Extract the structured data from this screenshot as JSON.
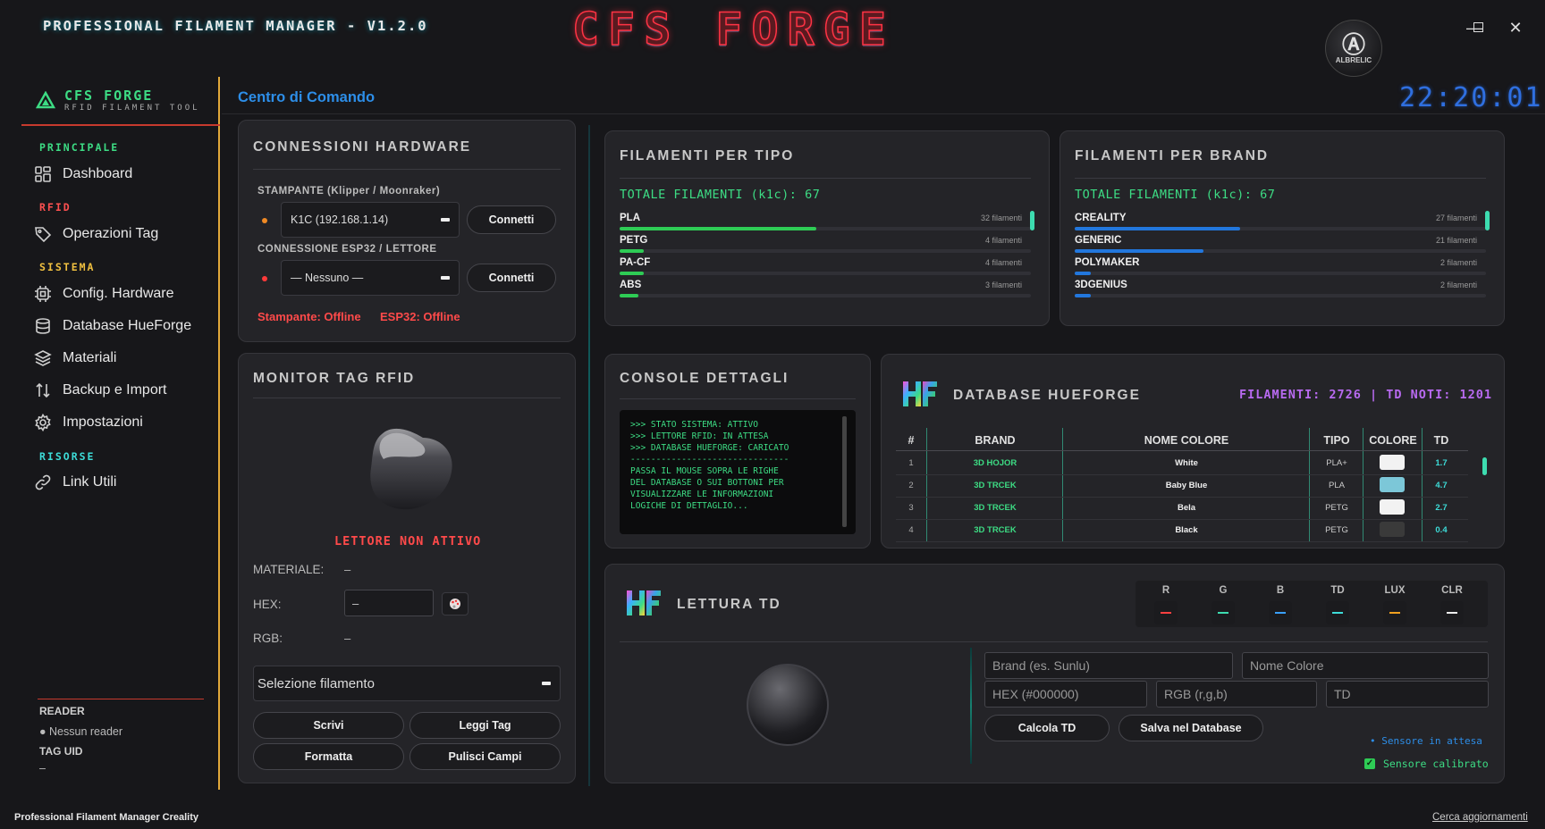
{
  "titlebar": {
    "app_title": "PROFESSIONAL FILAMENT MANAGER - V1.2.0",
    "banner": "CFS FORGE",
    "logo_text": "ALBRELIC",
    "minimize": "—",
    "maximize": "☐",
    "close": "✕"
  },
  "sidebar": {
    "brand_name": "CFS FORGE",
    "brand_sub": "RFID FILAMENT TOOL",
    "sections": {
      "principale": "PRINCIPALE",
      "rfid": "RFID",
      "sistema": "SISTEMA",
      "risorse": "RISORSE"
    },
    "items": [
      {
        "label": "Dashboard",
        "icon": "grid-icon"
      },
      {
        "label": "Operazioni Tag",
        "icon": "tag-icon"
      },
      {
        "label": "Config. Hardware",
        "icon": "chip-icon"
      },
      {
        "label": "Database HueForge",
        "icon": "database-icon"
      },
      {
        "label": "Materiali",
        "icon": "layers-icon"
      },
      {
        "label": "Backup e Import",
        "icon": "arrows-updown-icon"
      },
      {
        "label": "Impostazioni",
        "icon": "gear-icon"
      },
      {
        "label": "Link Utili",
        "icon": "link-icon"
      }
    ],
    "reader_label": "READER",
    "reader_value": "Nessun reader",
    "tag_uid_label": "TAG UID",
    "tag_uid_value": "–"
  },
  "header": {
    "title": "Centro di Comando",
    "clock": "22:20:01"
  },
  "hardware": {
    "title": "CONNESSIONI HARDWARE",
    "printer_label": "STAMPANTE (Klipper / Moonraker)",
    "printer_value": "K1C (192.168.1.14)",
    "printer_connect": "Connetti",
    "esp_label": "CONNESSIONE ESP32 / LETTORE",
    "esp_value": "— Nessuno —",
    "esp_connect": "Connetti",
    "printer_status": "Stampante: Offline",
    "esp_status": "ESP32: Offline",
    "printer_dot_color": "#f08a24",
    "esp_dot_color": "#ff3a3a"
  },
  "monitor": {
    "title": "MONITOR TAG RFID",
    "reader_state": "LETTORE NON ATTIVO",
    "material_label": "MATERIALE:",
    "material_value": "–",
    "hex_label": "HEX:",
    "hex_value": "–",
    "rgb_label": "RGB:",
    "rgb_value": "–",
    "select_placeholder": "Selezione filamento",
    "btn_write": "Scrivi",
    "btn_read": "Leggi Tag",
    "btn_format": "Formatta",
    "btn_clear": "Pulisci Campi"
  },
  "by_type": {
    "title": "FILAMENTI PER TIPO",
    "total": "TOTALE FILAMENTI (k1c): 67",
    "rows": [
      {
        "name": "PLA",
        "count": "32 filamenti",
        "value": 32
      },
      {
        "name": "PETG",
        "count": "4 filamenti",
        "value": 4
      },
      {
        "name": "PA-CF",
        "count": "4 filamenti",
        "value": 4
      },
      {
        "name": "ABS",
        "count": "3 filamenti",
        "value": 3
      }
    ],
    "bar_color": "#2ecc55"
  },
  "by_brand": {
    "title": "FILAMENTI PER BRAND",
    "total": "TOTALE FILAMENTI (k1c): 67",
    "rows": [
      {
        "name": "CREALITY",
        "count": "27 filamenti",
        "value": 27
      },
      {
        "name": "GENERIC",
        "count": "21 filamenti",
        "value": 21
      },
      {
        "name": "POLYMAKER",
        "count": "2 filamenti",
        "value": 2
      },
      {
        "name": "3DGENIUS",
        "count": "2 filamenti",
        "value": 2
      }
    ],
    "bar_color": "#2277dd"
  },
  "console": {
    "title": "CONSOLE DETTAGLI",
    "text": ">>> STATO SISTEMA: ATTIVO\n>>> LETTORE RFID: IN ATTESA\n>>> DATABASE HUEFORGE: CARICATO\n-------------------------------\nPASSA IL MOUSE SOPRA LE RIGHE\nDEL DATABASE O SUI BOTTONI PER\nVISUALIZZARE LE INFORMAZIONI\nLOGICHE DI DETTAGLIO..."
  },
  "hueforge": {
    "title": "DATABASE HUEFORGE",
    "stats": "FILAMENTI: 2726 | TD NOTI: 1201",
    "columns": [
      "#",
      "BRAND",
      "NOME COLORE",
      "TIPO",
      "COLORE",
      "TD"
    ],
    "rows": [
      {
        "n": "1",
        "brand": "3D HOJOR",
        "name": "White",
        "type": "PLA+",
        "color": "#f2f2f2",
        "td": "1.7"
      },
      {
        "n": "2",
        "brand": "3D TRCEK",
        "name": "Baby Blue",
        "type": "PLA",
        "color": "#7cc7d8",
        "td": "4.7"
      },
      {
        "n": "3",
        "brand": "3D TRCEK",
        "name": "Bela",
        "type": "PETG",
        "color": "#f2f2f2",
        "td": "2.7"
      },
      {
        "n": "4",
        "brand": "3D TRCEK",
        "name": "Black",
        "type": "PETG",
        "color": "#3a3a3a",
        "td": "0.4"
      }
    ]
  },
  "td": {
    "title": "LETTURA TD",
    "meters": [
      {
        "k": "R",
        "color": "#ff4040"
      },
      {
        "k": "G",
        "color": "#3ddcb0"
      },
      {
        "k": "B",
        "color": "#3aa0ff"
      },
      {
        "k": "TD",
        "color": "#3ddcd8"
      },
      {
        "k": "LUX",
        "color": "#f0a020"
      },
      {
        "k": "CLR",
        "color": "#eeeeee"
      }
    ],
    "brand_ph": "Brand (es. Sunlu)",
    "name_ph": "Nome Colore",
    "hex_ph": "HEX (#000000)",
    "rgb_ph": "RGB (r,g,b)",
    "td_ph": "TD",
    "btn_calc": "Calcola TD",
    "btn_save": "Salva nel Database",
    "sensor_wait": "• Sensore in attesa",
    "sensor_cal": "Sensore calibrato"
  },
  "footer": {
    "left": "Professional Filament Manager Creality",
    "right": "Cerca aggiornamenti"
  }
}
